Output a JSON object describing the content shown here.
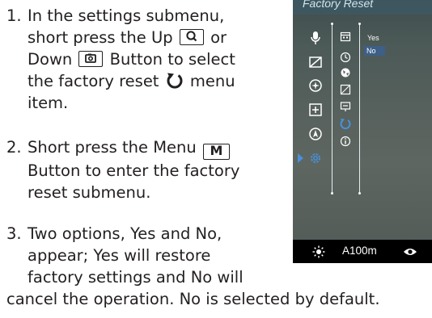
{
  "steps": [
    {
      "number": "1.",
      "lines": [
        "In the settings submenu,",
        "short press the Up",
        "or",
        "Down",
        "Button to select",
        "the factory reset",
        "menu",
        "item."
      ]
    },
    {
      "number": "2.",
      "lines": [
        "Short press the Menu",
        "Button to enter the factory",
        "reset submenu."
      ]
    },
    {
      "number": "3.",
      "lines": [
        "Two options, Yes and No,",
        "appear; Yes will restore",
        "factory settings and No will",
        "cancel the operation. No is selected by default."
      ]
    }
  ],
  "keys": {
    "menu": "M"
  },
  "device_screen": {
    "title": "Factory Reset",
    "options": [
      "Yes",
      "No"
    ],
    "selected_option": "No",
    "footer_value": "A100m",
    "colors": {
      "selection": "#3d5f88",
      "highlight": "#4a90d9",
      "footer": "#000000"
    }
  },
  "icons": {
    "up_key": "magnifier-icon",
    "down_key": "camera-icon",
    "factory_reset": "reset-arrow-icon"
  }
}
